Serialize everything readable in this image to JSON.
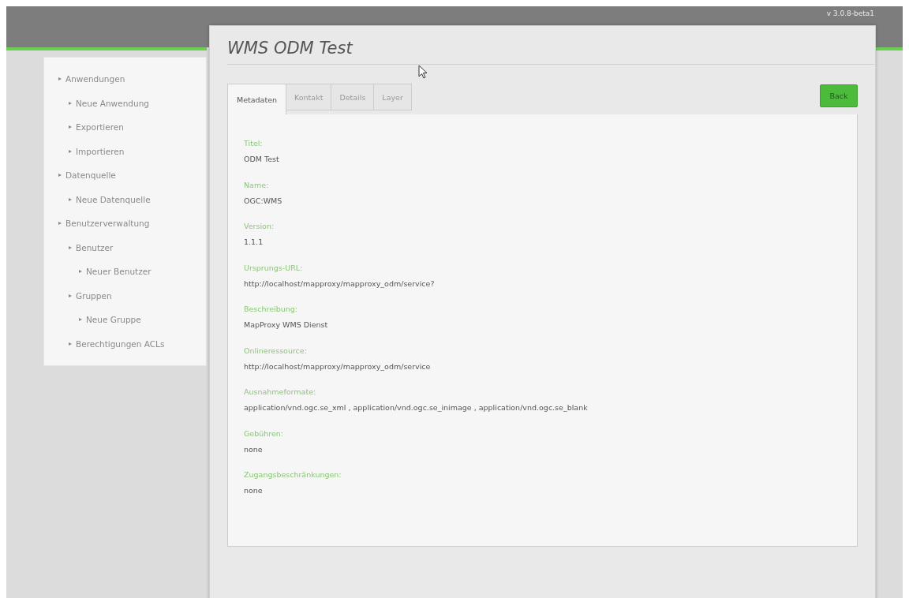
{
  "top_bar": {
    "version": "v 3.0.8-beta1"
  },
  "sidebar": {
    "items": [
      {
        "label": "Anwendungen",
        "children": [
          {
            "label": "Neue Anwendung"
          },
          {
            "label": "Exportieren"
          },
          {
            "label": "Importieren"
          }
        ]
      },
      {
        "label": "Datenquelle",
        "children": [
          {
            "label": "Neue Datenquelle"
          }
        ]
      },
      {
        "label": "Benutzerverwaltung",
        "children": [
          {
            "label": "Benutzer",
            "children": [
              {
                "label": "Neuer Benutzer"
              }
            ]
          },
          {
            "label": "Gruppen",
            "children": [
              {
                "label": "Neue Gruppe"
              }
            ]
          },
          {
            "label": "Berechtigungen ACLs"
          }
        ]
      }
    ]
  },
  "dialog": {
    "title": "WMS ODM Test",
    "tabs": [
      {
        "label": "Metadaten",
        "selected": true
      },
      {
        "label": "Kontakt",
        "selected": false
      },
      {
        "label": "Details",
        "selected": false
      },
      {
        "label": "Layer",
        "selected": false
      }
    ],
    "back_button": "Back",
    "fields": [
      {
        "label": "Titel:",
        "value": "ODM Test"
      },
      {
        "label": "Name:",
        "value": "OGC:WMS"
      },
      {
        "label": "Version:",
        "value": "1.1.1"
      },
      {
        "label": "Ursprungs-URL:",
        "value": "http://localhost/mapproxy/mapproxy_odm/service?"
      },
      {
        "label": "Beschreibung:",
        "value": "MapProxy WMS Dienst"
      },
      {
        "label": "Onlineressource:",
        "value": "http://localhost/mapproxy/mapproxy_odm/service"
      },
      {
        "label": "Ausnahmeformate:",
        "value": "application/vnd.ogc.se_xml , application/vnd.ogc.se_inimage , application/vnd.ogc.se_blank"
      },
      {
        "label": "Gebühren:",
        "value": "none"
      },
      {
        "label": "Zugangsbeschränkungen:",
        "value": "none"
      }
    ]
  }
}
